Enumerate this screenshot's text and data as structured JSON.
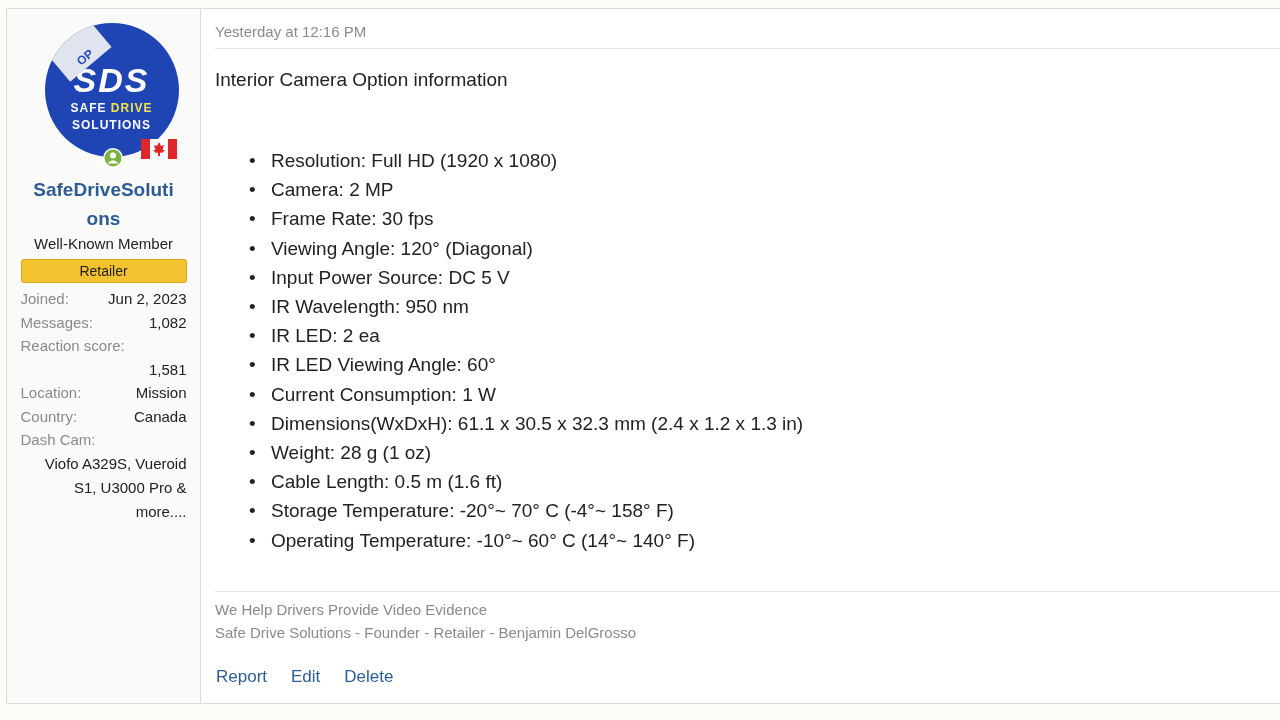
{
  "author": {
    "avatar": {
      "badge": "OP",
      "monogram": "SDS",
      "line_1": "SAFE",
      "line_2": "DRIVE",
      "line_3": "SOLUTIONS"
    },
    "online": true,
    "username": "SafeDriveSolutions",
    "title": "Well-Known Member",
    "banner": "Retailer",
    "stats": [
      {
        "kind": "inline",
        "label": "Joined:",
        "value": "Jun 2, 2023"
      },
      {
        "kind": "inline",
        "label": "Messages:",
        "value": "1,082"
      },
      {
        "kind": "stacked",
        "label": "Reaction score:",
        "value": "1,581"
      },
      {
        "kind": "inline",
        "label": "Location:",
        "value": "Mission"
      },
      {
        "kind": "inline",
        "label": "Country:",
        "value": "Canada"
      },
      {
        "kind": "stacked",
        "label": "Dash Cam:",
        "value": "Viofo A329S, Vueroid S1, U3000 Pro & more...."
      }
    ]
  },
  "post": {
    "date": "Yesterday at 12:16 PM",
    "heading": "Interior Camera Option information",
    "specs": [
      {
        "marker": "•",
        "text": "Resolution: Full HD (1920 x 1080)"
      },
      {
        "marker": "•",
        "text": "Camera: 2 MP"
      },
      {
        "marker": "•",
        "text": "Frame Rate: 30 fps"
      },
      {
        "marker": "•",
        "text": "Viewing Angle: 120° (Diagonal)"
      },
      {
        "marker": "•",
        "text": "Input Power Source: DC 5 V"
      },
      {
        "marker": "•",
        "text": "IR Wavelength: 950 nm"
      },
      {
        "marker": "•",
        "text": "IR LED: 2 ea"
      },
      {
        "marker": "•",
        "text": "IR LED Viewing Angle: 60°"
      },
      {
        "marker": "•",
        "text": "Current Consumption: 1 W"
      },
      {
        "marker": "•",
        "text": "Dimensions(WxDxH): 61.1 x 30.5 x 32.3 mm (2.4 x 1.2 x 1.3 in)"
      },
      {
        "marker": "•",
        "text": "Weight: 28 g (1 oz)"
      },
      {
        "marker": "•",
        "text": "Cable Length: 0.5 m (1.6 ft)"
      },
      {
        "marker": "•",
        "text": "Storage Temperature: -20°~ 70° C (-4°~ 158° F)"
      },
      {
        "marker": "•",
        "text": "Operating Temperature: -10°~ 60° C (14°~ 140° F)"
      }
    ],
    "signature": [
      "We Help Drivers Provide Video Evidence",
      "Safe Drive Solutions - Founder - Retailer - Benjamin DelGrosso"
    ],
    "actions": [
      "Report",
      "Edit",
      "Delete"
    ]
  }
}
